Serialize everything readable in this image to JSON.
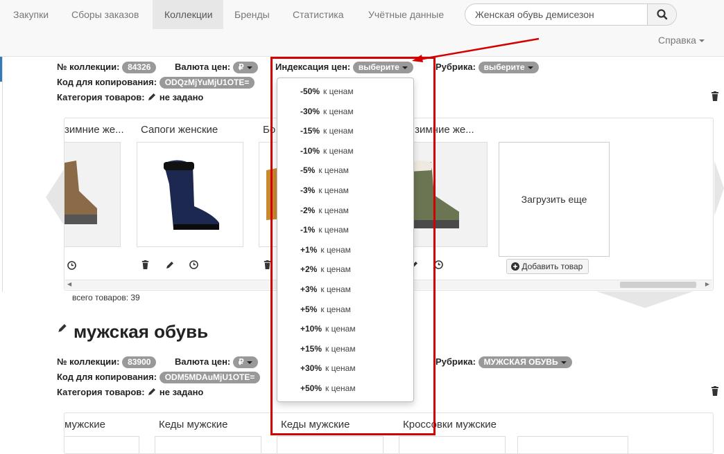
{
  "nav": {
    "items": [
      "Закупки",
      "Сборы заказов",
      "Коллекции",
      "Бренды",
      "Статистика",
      "Учётные данные"
    ],
    "active_index": 2
  },
  "search": {
    "value": "Женская обувь демисезон"
  },
  "help": {
    "label": "Справка"
  },
  "collection1": {
    "number_label": "№ коллекции:",
    "number": "84326",
    "currency_label": "Валюта цен:",
    "currency": "₽",
    "index_label": "Индексация цен:",
    "index_value": "выберите",
    "rubric_label": "Рубрика:",
    "rubric_value": "выберите",
    "copy_code_label": "Код для копирования:",
    "copy_code": "ODQzMjYuMjU1OTE=",
    "category_label": "Категория товаров:",
    "category_value": "не задано",
    "products": [
      {
        "title": "Ботинки зимние же...",
        "visible_title": "зимние же..."
      },
      {
        "title": "Сапоги женские"
      },
      {
        "title": "Бо"
      },
      {
        "title": "Ботинки зимние же...",
        "visible_title": "ки зимние же..."
      }
    ],
    "load_more": "Загрузить еще",
    "add_product": "Добавить товар",
    "total": "всего товаров: 39"
  },
  "collection2": {
    "title": "мужская обувь",
    "number_label": "№ коллекции:",
    "number": "83900",
    "currency_label": "Валюта цен:",
    "currency": "₽",
    "rubric_label": "Рубрика:",
    "rubric_value": "МУЖСКАЯ ОБУВЬ",
    "copy_code_label": "Код для копирования:",
    "copy_code": "ODM5MDAuMjU1OTE=",
    "category_label": "Категория товаров:",
    "category_value": "не задано",
    "products": [
      "мужские",
      "Кеды мужские",
      "Кеды мужские",
      "Кроссовки мужские"
    ]
  },
  "index_dropdown": {
    "suffix": "к ценам",
    "options": [
      "-50%",
      "-30%",
      "-15%",
      "-10%",
      "-5%",
      "-3%",
      "-2%",
      "-1%",
      "+1%",
      "+2%",
      "+3%",
      "+5%",
      "+10%",
      "+15%",
      "+30%",
      "+50%"
    ]
  },
  "colors": {
    "highlight": "#d40000",
    "badge": "#999999",
    "nav_active": "#e7e7e7"
  }
}
